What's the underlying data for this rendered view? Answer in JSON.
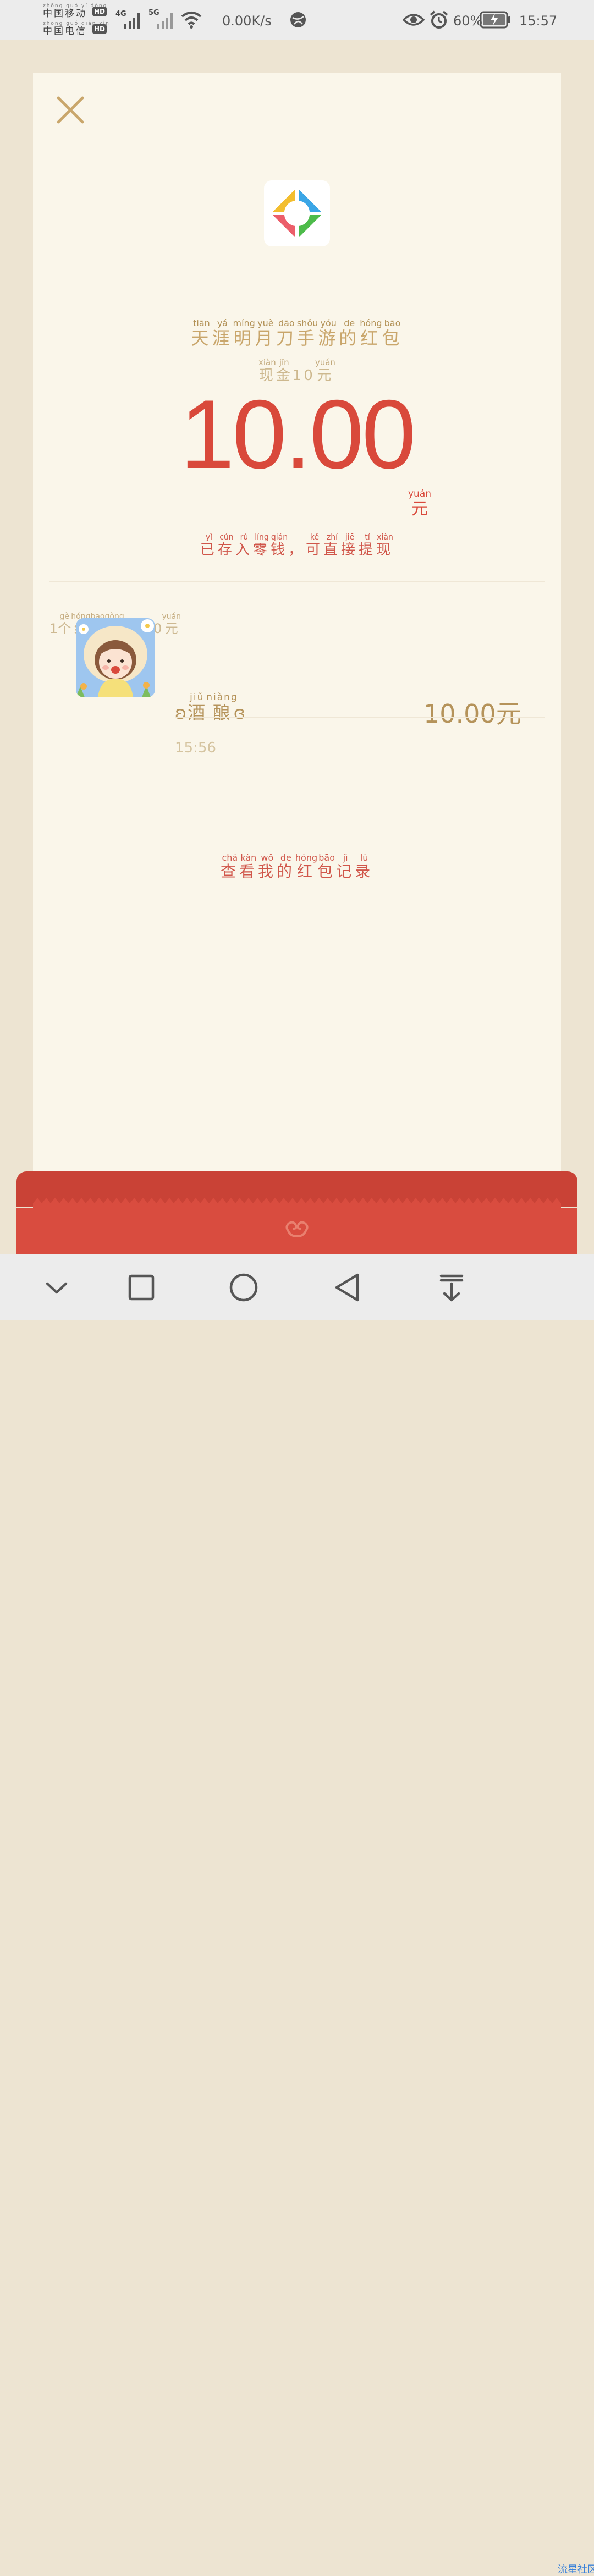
{
  "status_bar": {
    "carrier1_pinyin": "zhōng guó yí dòng",
    "carrier1": "中国移动",
    "carrier2_pinyin": "zhōng guó diàn xìn",
    "carrier2": "中国电信",
    "hd": "HD",
    "net1": "4G",
    "net2": "5G",
    "speed": "0.00K/s",
    "battery": "60%",
    "time": "15:57"
  },
  "packet": {
    "sender_title": [
      {
        "zh": "天",
        "py": "tiān"
      },
      {
        "zh": "涯",
        "py": "yá"
      },
      {
        "zh": "明",
        "py": "míng"
      },
      {
        "zh": "月",
        "py": "yuè"
      },
      {
        "zh": "刀",
        "py": "dāo"
      },
      {
        "zh": "手",
        "py": "shǒu"
      },
      {
        "zh": "游",
        "py": "yóu"
      },
      {
        "zh": "的",
        "py": "de"
      },
      {
        "zh": "红",
        "py": "hóng"
      },
      {
        "zh": "包",
        "py": "bāo"
      }
    ],
    "subtitle": [
      {
        "zh": "现",
        "py": "xiàn"
      },
      {
        "zh": "金",
        "py": "jīn"
      },
      {
        "zh": "10",
        "py": ""
      },
      {
        "zh": "元",
        "py": "yuán"
      }
    ],
    "amount": "10.00",
    "amount_unit": "元",
    "amount_unit_pinyin": "yuán",
    "notice": [
      {
        "zh": "已",
        "py": "yǐ"
      },
      {
        "zh": "存",
        "py": "cún"
      },
      {
        "zh": "入",
        "py": "rù"
      },
      {
        "zh": "零",
        "py": "líng"
      },
      {
        "zh": "钱",
        "py": "qián"
      },
      {
        "zh": "，",
        "py": ""
      },
      {
        "zh": "可",
        "py": "kě"
      },
      {
        "zh": "直",
        "py": "zhí"
      },
      {
        "zh": "接",
        "py": "jiē"
      },
      {
        "zh": "提",
        "py": "tí"
      },
      {
        "zh": "现",
        "py": "xiàn"
      }
    ],
    "summary": [
      {
        "zh": "1",
        "py": ""
      },
      {
        "zh": "个",
        "py": "gè"
      },
      {
        "zh": "红",
        "py": "hóng"
      },
      {
        "zh": "包",
        "py": "bāo"
      },
      {
        "zh": "共",
        "py": "gòng"
      },
      {
        "zh": "10.00",
        "py": ""
      },
      {
        "zh": "元",
        "py": "yuán"
      }
    ]
  },
  "receiver": {
    "name_prefix": "ʚ",
    "name": [
      {
        "zh": "酒",
        "py": "jiǔ"
      },
      {
        "zh": "酿",
        "py": "niàng"
      }
    ],
    "name_suffix": "ɞ",
    "time": "15:56",
    "amount": "10.00元"
  },
  "records_link": [
    {
      "zh": "查",
      "py": "chá"
    },
    {
      "zh": "看",
      "py": "kàn"
    },
    {
      "zh": "我",
      "py": "wǒ"
    },
    {
      "zh": "的",
      "py": "de"
    },
    {
      "zh": "红",
      "py": "hóng"
    },
    {
      "zh": "包",
      "py": "bāo"
    },
    {
      "zh": "记",
      "py": "jì"
    },
    {
      "zh": "录",
      "py": "lù"
    }
  ],
  "watermark": "流星社区",
  "colors": {
    "accent_red": "#d9493b",
    "gold": "#b5935a",
    "card_bg": "#faf6ea",
    "page_bg": "#ede4d2"
  },
  "icons": {
    "close": "close-icon",
    "logo": "app-logo-icon",
    "nav": [
      "chevron-down-icon",
      "square-icon",
      "circle-icon",
      "back-triangle-icon",
      "download-icon"
    ]
  }
}
